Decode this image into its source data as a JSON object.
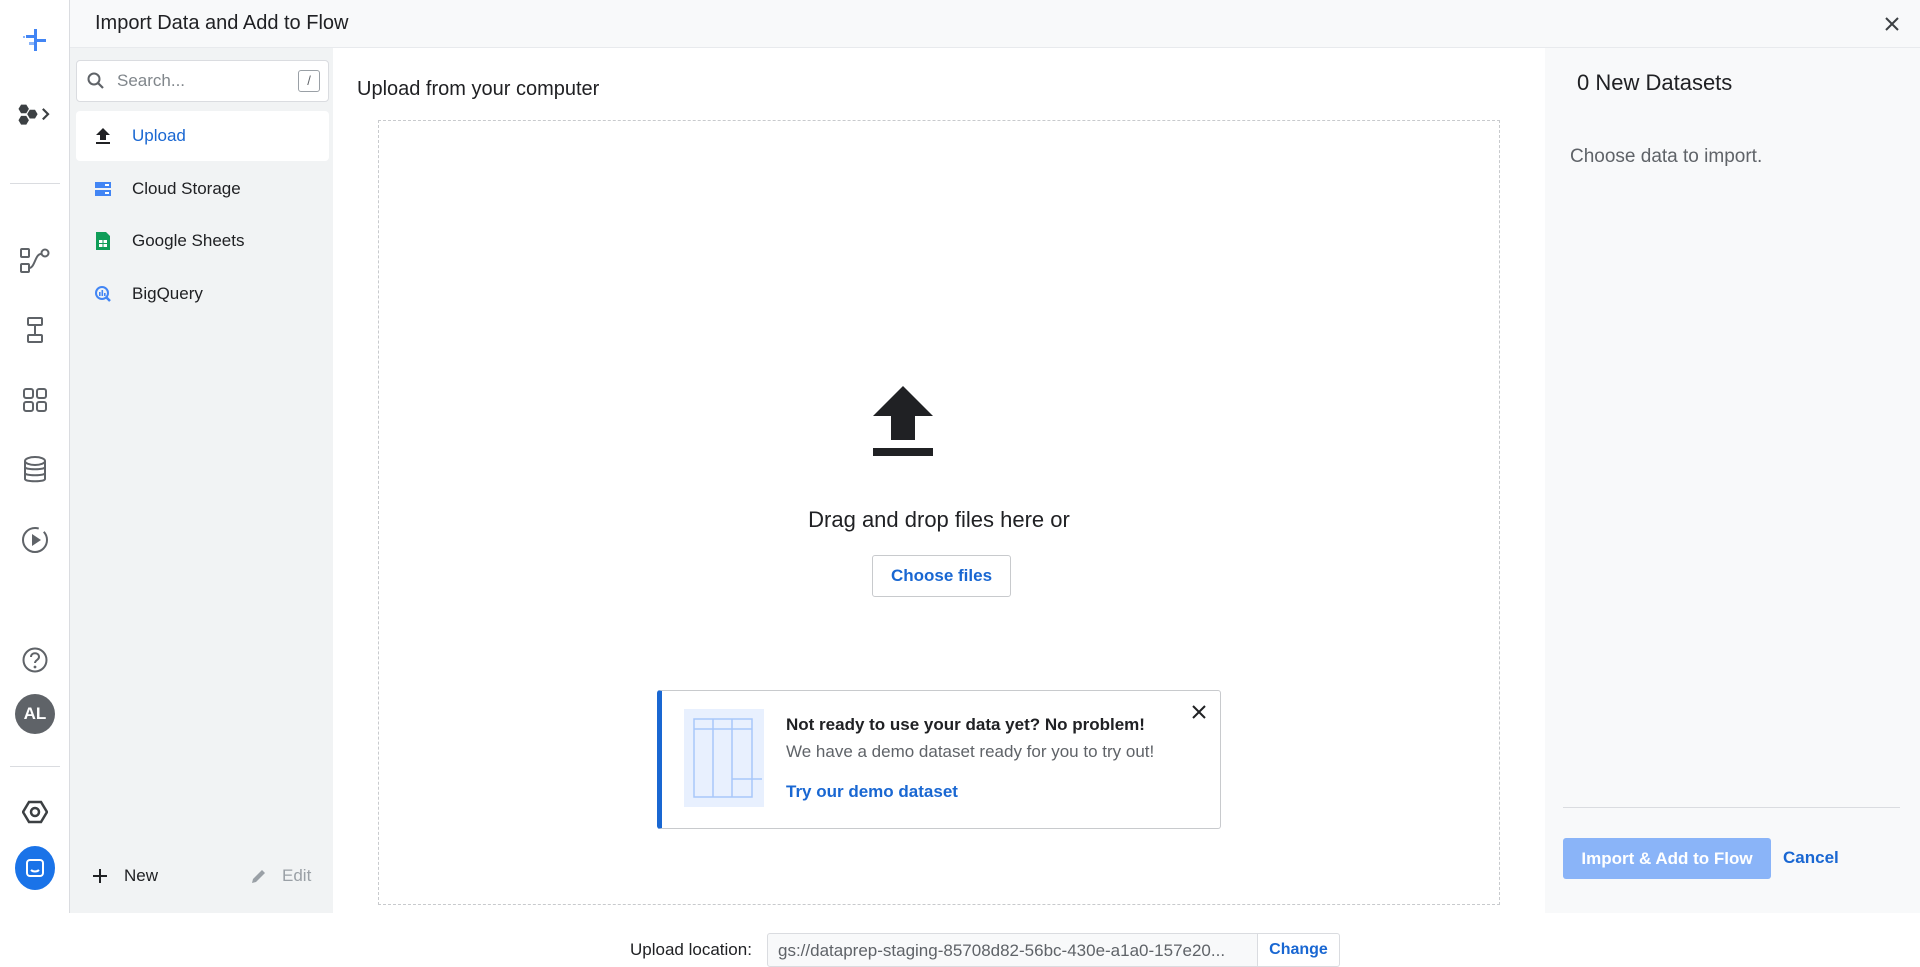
{
  "header": {
    "title": "Import Data and Add to Flow"
  },
  "rail": {
    "icons": [
      "dataprep-logo-icon",
      "hexagons-expand-icon",
      "flows-icon",
      "plans-icon",
      "library-icon",
      "datasets-icon",
      "jobs-icon",
      "help-icon",
      "gcp-icon",
      "chat-icon"
    ],
    "avatar": "AL"
  },
  "sources": {
    "search_placeholder": "Search...",
    "search_shortcut": "/",
    "items": [
      {
        "label": "Upload",
        "icon": "upload-icon",
        "active": true
      },
      {
        "label": "Cloud Storage",
        "icon": "cloud-storage-icon",
        "active": false
      },
      {
        "label": "Google Sheets",
        "icon": "google-sheets-icon",
        "active": false
      },
      {
        "label": "BigQuery",
        "icon": "bigquery-icon",
        "active": false
      }
    ],
    "new_label": "New",
    "edit_label": "Edit"
  },
  "main": {
    "heading": "Upload from your computer",
    "drag_text": "Drag and drop files here or",
    "choose_label": "Choose files",
    "demo": {
      "title": "Not ready to use your data yet? No problem!",
      "subtitle": "We have a demo dataset ready for you to try out!",
      "link": "Try our demo dataset"
    },
    "location_label": "Upload location:",
    "location_value": "gs://dataprep-staging-85708d82-56bc-430e-a1a0-157e20...",
    "change_label": "Change"
  },
  "right": {
    "title": "0 New Datasets",
    "message": "Choose data to import.",
    "import_label": "Import & Add to Flow",
    "cancel_label": "Cancel"
  },
  "colors": {
    "accent": "#1967d2",
    "disabled_button": "#8ab4f8",
    "sheets_green": "#0f9d58"
  }
}
